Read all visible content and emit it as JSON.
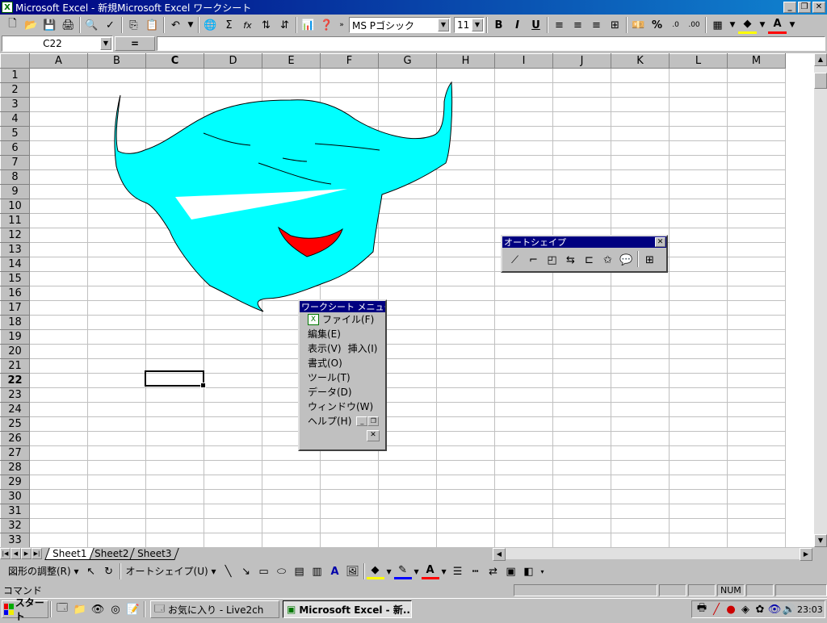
{
  "window": {
    "title": "Microsoft Excel - 新規Microsoft Excel ワークシート",
    "app_icon": "excel-icon",
    "buttons": [
      "minimize",
      "restore",
      "close"
    ]
  },
  "toolbar": {
    "font_name": "MS Pゴシック",
    "font_size": "11",
    "bold": "B",
    "italic": "I",
    "underline": "U",
    "percent": "%",
    "sum": "Σ",
    "function": "fx"
  },
  "formula_bar": {
    "name_box": "C22",
    "equals_label": "=",
    "content": ""
  },
  "sheet": {
    "columns": [
      "A",
      "B",
      "C",
      "D",
      "E",
      "F",
      "G",
      "H",
      "I",
      "J",
      "K",
      "L",
      "M"
    ],
    "rows": [
      "1",
      "2",
      "3",
      "4",
      "5",
      "6",
      "7",
      "8",
      "9",
      "10",
      "11",
      "12",
      "13",
      "14",
      "15",
      "16",
      "17",
      "18",
      "19",
      "20",
      "21",
      "22",
      "23",
      "24",
      "25",
      "26",
      "27",
      "28",
      "29",
      "30",
      "31",
      "32",
      "33"
    ],
    "selected_column": "C",
    "selected_row": "22",
    "shape_colors": {
      "face": "#00ffff",
      "mouth": "#ff0000",
      "eyes": "#ffffff",
      "outline": "#000000"
    }
  },
  "sheet_tabs": [
    "Sheet1",
    "Sheet2",
    "Sheet3"
  ],
  "active_tab": "Sheet1",
  "autoshape_palette": {
    "title": "オートシェイプ",
    "icons": [
      "lines-icon",
      "connectors-icon",
      "basic-shapes-icon",
      "block-arrows-icon",
      "flowchart-icon",
      "stars-banners-icon",
      "callouts-icon",
      "more-autoshapes-icon"
    ]
  },
  "worksheet_menu": {
    "title": "ワークシート メニュー バー",
    "items": [
      {
        "label": "ファイル(F)"
      },
      {
        "label": "編集(E)"
      },
      {
        "label": "表示(V)"
      },
      {
        "label": "挿入(I)"
      },
      {
        "label": "書式(O)"
      },
      {
        "label": "ツール(T)"
      },
      {
        "label": "データ(D)"
      },
      {
        "label": "ウィンドウ(W)"
      },
      {
        "label": "ヘルプ(H)"
      }
    ]
  },
  "drawing_toolbar": {
    "draw_menu": "図形の調整(R)",
    "autoshapes_menu": "オートシェイプ(U)"
  },
  "status_bar": {
    "text": "コマンド",
    "num_indicator": "NUM"
  },
  "taskbar": {
    "start_label": "スタート",
    "tasks": [
      {
        "label": "お気に入り - Live2ch"
      },
      {
        "label": "Microsoft Excel - 新..."
      }
    ],
    "clock": "23:03"
  }
}
